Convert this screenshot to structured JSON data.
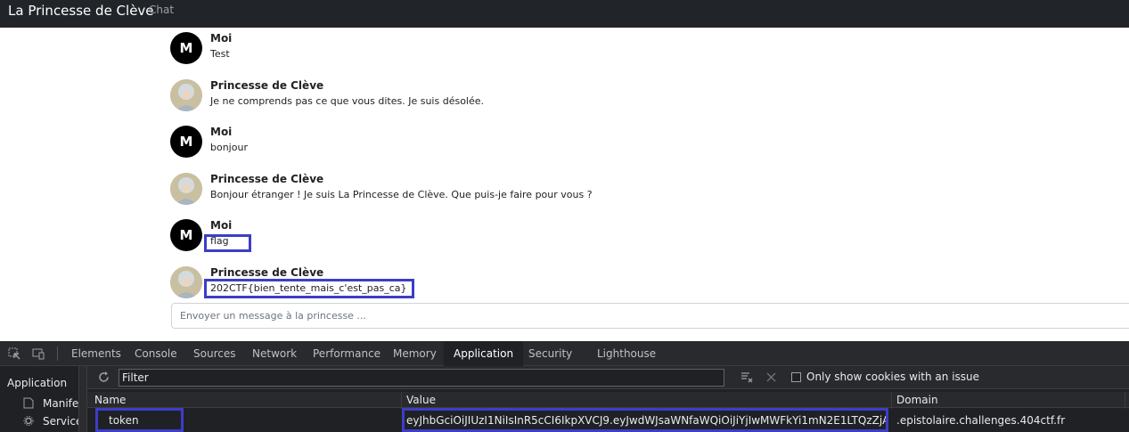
{
  "header": {
    "brand": "La Princesse de Clève",
    "nav_chat": "Chat"
  },
  "messages": [
    {
      "author": "Moi",
      "avatar_letter": "M",
      "avatar": "letter",
      "text": "Test"
    },
    {
      "author": "Princesse de Clève",
      "avatar": "portrait",
      "text": "Je ne comprends pas ce que vous dites. Je suis désolée."
    },
    {
      "author": "Moi",
      "avatar_letter": "M",
      "avatar": "letter",
      "text": "bonjour"
    },
    {
      "author": "Princesse de Clève",
      "avatar": "portrait",
      "text": "Bonjour étranger ! Je suis La Princesse de Clève. Que puis-je faire pour vous ?"
    },
    {
      "author": "Moi",
      "avatar_letter": "M",
      "avatar": "letter",
      "text": "flag"
    },
    {
      "author": "Princesse de Clève",
      "avatar": "portrait",
      "text": "202CTF{bien_tente_mais_c'est_pas_ca}"
    }
  ],
  "composer": {
    "placeholder": "Envoyer un message à la princesse ..."
  },
  "devtools": {
    "tabs": [
      "Elements",
      "Console",
      "Sources",
      "Network",
      "Performance",
      "Memory",
      "Application",
      "Security",
      "Lighthouse"
    ],
    "active_tab": "Application",
    "sidebar": {
      "title": "Application",
      "items": [
        "Manifest",
        "Service Workers"
      ]
    },
    "filter_placeholder": "Filter",
    "only_issue_label": "Only show cookies with an issue",
    "columns": [
      "Name",
      "Value",
      "Domain"
    ],
    "cookie": {
      "name": "token",
      "value": "eyJhbGciOiJIUzI1NiIsInR5cCI6IkpXVCJ9.eyJwdWJsaWNfaWQiOiJiYjIwMWFkYi1mN2E1LTQzZjAtYTdlO...",
      "domain": ".epistolaire.challenges.404ctf.fr"
    }
  },
  "colors": {
    "highlight": "#3d3dc8",
    "topbar": "#212529",
    "devtools_bg": "#202124"
  }
}
